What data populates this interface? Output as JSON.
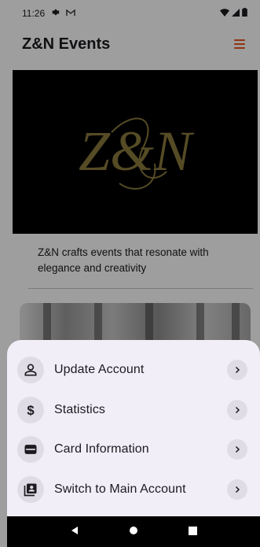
{
  "status_bar": {
    "time": "11:26"
  },
  "app_bar": {
    "title": "Z&N Events"
  },
  "hero": {
    "logo_text": "Z&N"
  },
  "main": {
    "description": "Z&N crafts events that resonate with elegance and creativity"
  },
  "bottom_sheet": {
    "items": [
      {
        "label": "Update Account",
        "icon": "person-icon"
      },
      {
        "label": "Statistics",
        "icon": "dollar-icon"
      },
      {
        "label": "Card Information",
        "icon": "wallet-icon"
      },
      {
        "label": "Switch to Main Account",
        "icon": "switch-account-icon"
      }
    ]
  },
  "colors": {
    "accent": "#e8541c",
    "sheet_bg": "#f2eef8",
    "logo_gold": "#8a7a3c"
  }
}
